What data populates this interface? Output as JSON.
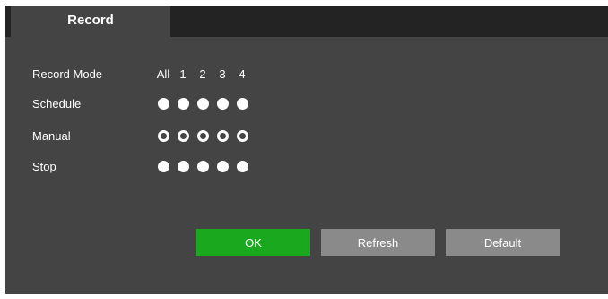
{
  "tabs": {
    "active_label": "Record"
  },
  "record_mode": {
    "label": "Record Mode",
    "columns": [
      "All",
      "1",
      "2",
      "3",
      "4"
    ]
  },
  "rows": [
    {
      "label": "Schedule",
      "selected": [
        false,
        false,
        false,
        false,
        false
      ]
    },
    {
      "label": "Manual",
      "selected": [
        true,
        true,
        true,
        true,
        true
      ]
    },
    {
      "label": "Stop",
      "selected": [
        false,
        false,
        false,
        false,
        false
      ]
    }
  ],
  "buttons": {
    "ok_label": "OK",
    "refresh_label": "Refresh",
    "default_label": "Default"
  },
  "colors": {
    "ok": "#1aa81f",
    "secondary": "#8a8a8a",
    "panel": "#444444",
    "tabbar": "#232323"
  }
}
